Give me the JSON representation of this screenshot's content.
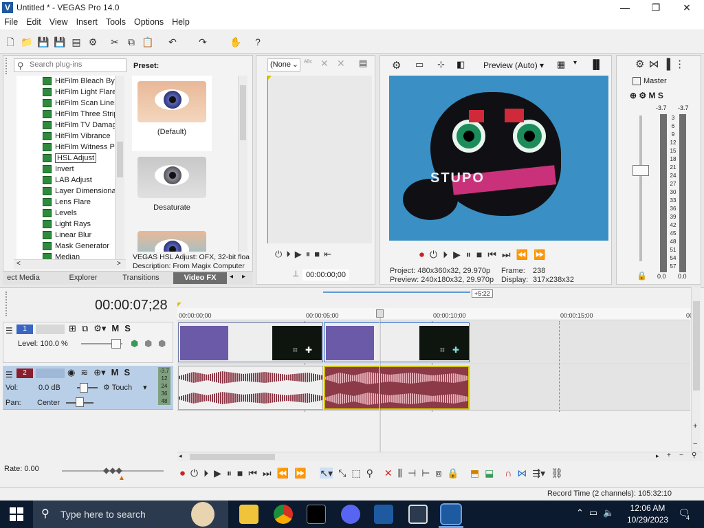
{
  "window": {
    "title": "Untitled * - VEGAS Pro 14.0",
    "app_icon": "vegas-icon",
    "minimize": "—",
    "maximize": "❐",
    "close": "✕"
  },
  "menu": [
    "File",
    "Edit",
    "View",
    "Insert",
    "Tools",
    "Options",
    "Help"
  ],
  "plugins": {
    "search_placeholder": "Search plug-ins",
    "items": [
      "HitFilm Bleach Byp",
      "HitFilm Light Flares",
      "HitFilm Scan Lines",
      "HitFilm Three Strip",
      "HitFilm TV Damage",
      "HitFilm Vibrance",
      "HitFilm Witness Pr",
      "HSL Adjust",
      "Invert",
      "LAB Adjust",
      "Layer Dimensional",
      "Lens Flare",
      "Levels",
      "Light Rays",
      "Linear Blur",
      "Mask Generator",
      "Median"
    ],
    "selected": "HSL Adjust",
    "preset_label": "Preset:",
    "presets": [
      "(Default)",
      "Desaturate"
    ],
    "info_line1": "VEGAS HSL Adjust: OFX, 32-bit floa",
    "info_line2": "Description: From Magix Computer",
    "tabs": [
      "ect Media",
      "Explorer",
      "Transitions",
      "Video FX"
    ],
    "active_tab": "Video FX"
  },
  "trimmer": {
    "dropdown": "(None",
    "timecode": "00:00:00;00"
  },
  "preview": {
    "quality": "Preview (Auto)",
    "project_label": "Project:",
    "project_value": "480x360x32, 29.970p",
    "preview_label": "Preview:",
    "preview_value": "240x180x32, 29.970p",
    "frame_label": "Frame:",
    "frame_value": "238",
    "display_label": "Display:",
    "display_value": "317x238x32",
    "video_text": "STUPO"
  },
  "master": {
    "label": "Master",
    "db_left": "-3.7",
    "db_right": "-3.7",
    "scale": [
      "3",
      "6",
      "9",
      "12",
      "15",
      "18",
      "21",
      "24",
      "27",
      "30",
      "33",
      "36",
      "39",
      "42",
      "45",
      "48",
      "51",
      "54",
      "57"
    ],
    "bottom_left": "0.0",
    "bottom_right": "0.0"
  },
  "timeline": {
    "timecode": "00:00:07;28",
    "duration_badge": "+5:22",
    "ruler": [
      "00:00:00;00",
      "00:00:05;00",
      "00:00:10;00",
      "00:00:15;00",
      "00:0"
    ],
    "video_track": {
      "number": "1",
      "level_label": "Level:",
      "level_value": "100.0 %",
      "mute": "M",
      "solo": "S"
    },
    "audio_track": {
      "number": "2",
      "vol_label": "Vol:",
      "vol_value": "0.0 dB",
      "pan_label": "Pan:",
      "pan_value": "Center",
      "mode": "Touch",
      "mute": "M",
      "solo": "S",
      "meter": [
        "-3.7",
        "12",
        "24",
        "36",
        "48"
      ]
    },
    "rate_label": "Rate: 0.00",
    "record_time": "Record Time (2 channels): 105:32:10"
  },
  "taskbar": {
    "search_placeholder": "Type here to search",
    "time": "12:06 AM",
    "date": "10/29/2023",
    "notifications": "4"
  },
  "colors": {
    "accent": "#b9cfe8",
    "video_clip": "#6b5aa8",
    "audio_clip": "#8c3a48",
    "taskbar": "#0b1a2e"
  }
}
